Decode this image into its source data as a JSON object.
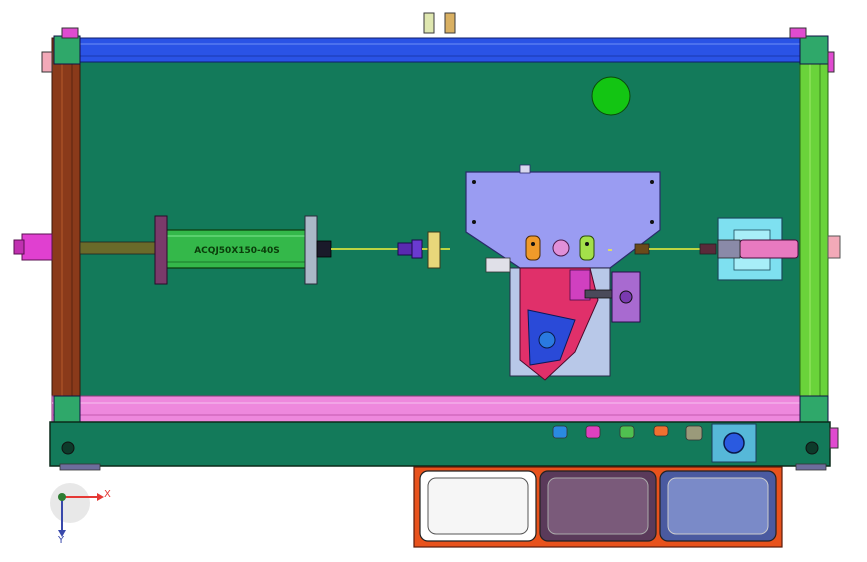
{
  "drawing": {
    "cylinder_label": "ACQJ50X150-40S",
    "axis_x_label": "X",
    "axis_y_label": "Y"
  },
  "colors": {
    "plate": "#137a5a",
    "frame_top": "#2a53e6",
    "frame_bottom": "#ee88dd",
    "frame_left": "#8a3a1a",
    "frame_right": "#6ad33a",
    "base_plate": "#137a5a",
    "mount_plate": "#9a9cf2",
    "cylinder_body": "#34b84a",
    "tray_border": "#e8521c",
    "axis_x": "#e53935",
    "axis_y": "#3949ab",
    "origin": "#2e7d32"
  },
  "icons": [
    "triad-axis-icon",
    "green-sensor-disc-icon",
    "blue-knob-icon"
  ]
}
